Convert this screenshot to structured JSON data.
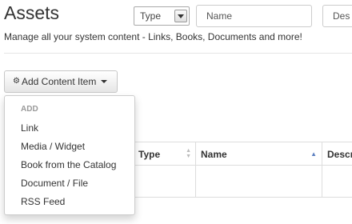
{
  "header": {
    "title": "Assets",
    "subtitle": "Manage all your system content - Links, Books, Documents and more!"
  },
  "add_button": {
    "icon": "gear-icon",
    "label": "Add Content Item"
  },
  "dropdown": {
    "header": "ADD",
    "items": [
      {
        "label": "Link"
      },
      {
        "label": "Media / Widget"
      },
      {
        "label": "Book from the Catalog"
      },
      {
        "label": "Document / File"
      },
      {
        "label": "RSS Feed"
      }
    ]
  },
  "table": {
    "columns": [
      {
        "label": "Type",
        "sort": "none"
      },
      {
        "label": "Name",
        "sort": "ascending"
      },
      {
        "label": "Descr",
        "sort": "none"
      }
    ],
    "filters": {
      "type_value": "Type",
      "name_placeholder": "Name",
      "desc_placeholder": "Des"
    }
  },
  "colors": {
    "sort_active": "#5b7fc0",
    "border": "#dddddd"
  }
}
